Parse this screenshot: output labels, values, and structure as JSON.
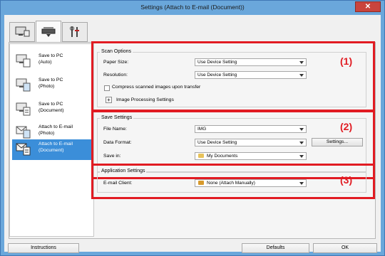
{
  "window": {
    "title": "Settings (Attach to E-mail (Document))",
    "close_label": "✕"
  },
  "tabs": [
    {
      "name": "tab-scan-from-computer",
      "icon": "computer-scan-icon"
    },
    {
      "name": "tab-scan-from-panel",
      "icon": "scanner-icon"
    },
    {
      "name": "tab-general-settings",
      "icon": "tools-icon"
    }
  ],
  "nav": {
    "items": [
      {
        "label": "Save to PC\n(Auto)",
        "icon": "save-to-pc-auto-icon"
      },
      {
        "label": "Save to PC\n(Photo)",
        "icon": "save-to-pc-photo-icon"
      },
      {
        "label": "Save to PC\n(Document)",
        "icon": "save-to-pc-document-icon"
      },
      {
        "label": "Attach to E-mail\n(Photo)",
        "icon": "attach-email-photo-icon"
      },
      {
        "label": "Attach to E-mail\n(Document)",
        "icon": "attach-email-document-icon",
        "selected": true
      }
    ]
  },
  "scan_options": {
    "title": "Scan Options",
    "paper_size_label": "Paper Size:",
    "paper_size_value": "Use Device Setting",
    "resolution_label": "Resolution:",
    "resolution_value": "Use Device Setting",
    "compress_label": "Compress scanned images upon transfer",
    "compress_checked": false,
    "image_processing_label": "Image Processing Settings"
  },
  "save_settings": {
    "title": "Save Settings",
    "file_name_label": "File Name:",
    "file_name_value": "IMG",
    "data_format_label": "Data Format:",
    "data_format_value": "Use Device Setting",
    "settings_button": "Settings...",
    "save_in_label": "Save in:",
    "save_in_value": "My Documents"
  },
  "application_settings": {
    "title": "Application Settings",
    "email_client_label": "E-mail Client:",
    "email_client_value": "None (Attach Manually)"
  },
  "markers": {
    "one": "(1)",
    "two": "(2)",
    "three": "(3)"
  },
  "buttons": {
    "instructions": "Instructions",
    "defaults": "Defaults",
    "ok": "OK"
  },
  "colors": {
    "highlight": "#e11b22",
    "selection": "#3b8ed9",
    "window_frame": "#6aa7db"
  }
}
